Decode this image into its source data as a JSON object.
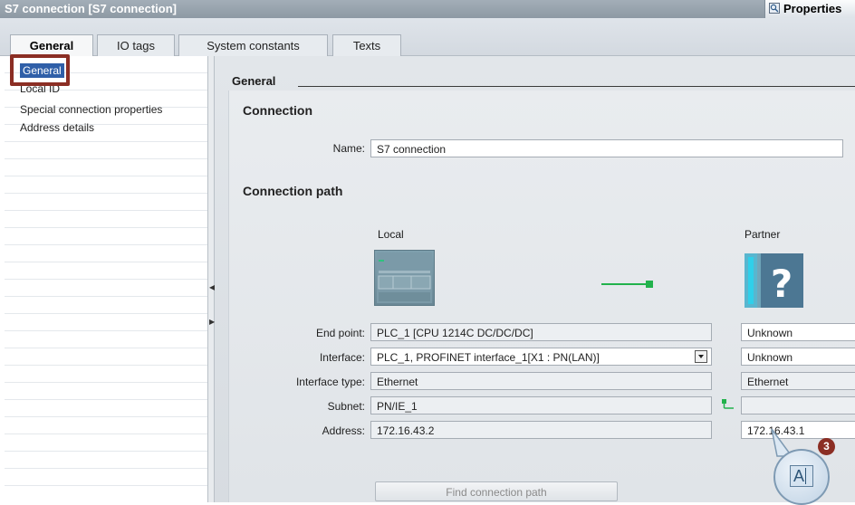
{
  "window": {
    "title": "S7 connection [S7 connection]",
    "properties_label": "Properties",
    "properties_icon": "properties-icon"
  },
  "tabs": [
    {
      "label": "General",
      "active": true
    },
    {
      "label": "IO tags",
      "active": false
    },
    {
      "label": "System constants",
      "active": false
    },
    {
      "label": "Texts",
      "active": false
    }
  ],
  "sidebar": {
    "items": [
      {
        "label": "General",
        "selected": true
      },
      {
        "label": "Local ID",
        "selected": false
      },
      {
        "label": "Special connection properties",
        "selected": false
      },
      {
        "label": "Address details",
        "selected": false
      }
    ]
  },
  "content": {
    "heading": "General",
    "connection": {
      "section_title": "Connection",
      "name_label": "Name:",
      "name_value": "S7 connection"
    },
    "path": {
      "section_title": "Connection path",
      "local_label": "Local",
      "partner_label": "Partner",
      "rows": [
        {
          "label": "End point:",
          "local": "PLC_1 [CPU 1214C DC/DC/DC]",
          "partner": "Unknown"
        },
        {
          "label": "Interface:",
          "local": "PLC_1, PROFINET interface_1[X1 : PN(LAN)]",
          "partner": "Unknown"
        },
        {
          "label": "Interface type:",
          "local": "Ethernet",
          "partner": "Ethernet"
        },
        {
          "label": "Subnet:",
          "local": "PN/IE_1",
          "partner": ""
        },
        {
          "label": "Address:",
          "local": "172.16.43.2",
          "partner": "172.16.43.1"
        }
      ],
      "find_button": "Find connection path"
    }
  },
  "callout": {
    "number": "3",
    "glyph": "A"
  },
  "colors": {
    "title_bar": "#8d99a4",
    "selection": "#2f5fa8",
    "highlight": "#8b2e24",
    "connection_line": "#22b24c"
  }
}
